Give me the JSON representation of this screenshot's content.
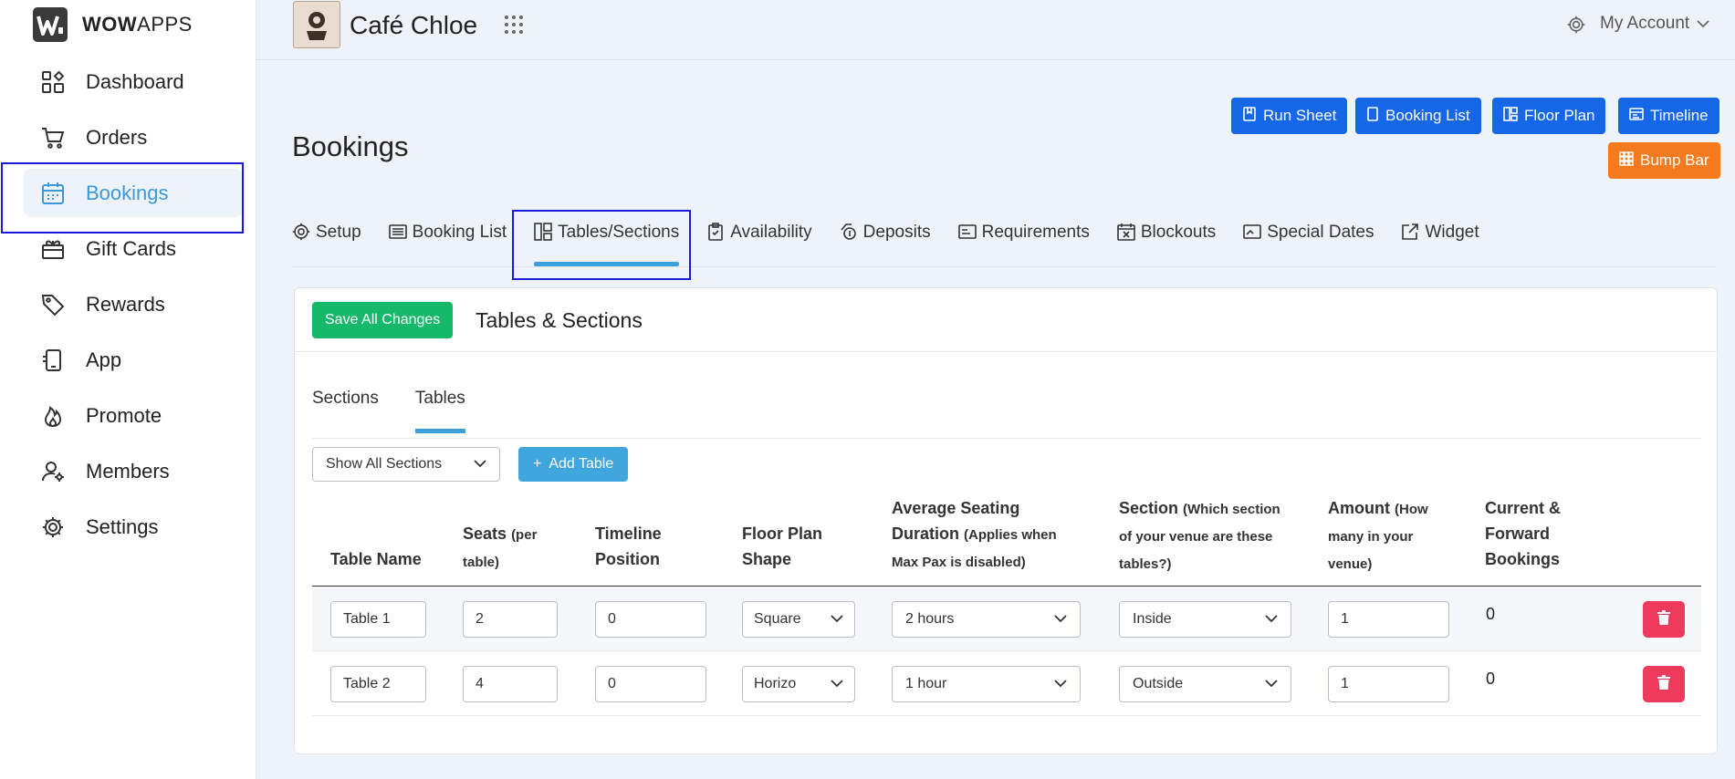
{
  "app": {
    "logo_bold": "WOW",
    "logo_light": "APPS"
  },
  "sidebar": {
    "items": [
      {
        "label": "Dashboard",
        "icon": "dashboard-icon"
      },
      {
        "label": "Orders",
        "icon": "cart-icon"
      },
      {
        "label": "Bookings",
        "icon": "calendar-icon",
        "active": true
      },
      {
        "label": "Gift Cards",
        "icon": "gift-card-icon"
      },
      {
        "label": "Rewards",
        "icon": "tag-icon"
      },
      {
        "label": "App",
        "icon": "mobile-icon"
      },
      {
        "label": "Promote",
        "icon": "flame-icon"
      },
      {
        "label": "Members",
        "icon": "members-icon"
      },
      {
        "label": "Settings",
        "icon": "gear-icon"
      }
    ]
  },
  "topbar": {
    "venue_name": "Café Chloe",
    "account_label": "My Account"
  },
  "page": {
    "title": "Bookings",
    "actions": {
      "run_sheet": "Run Sheet",
      "booking_list": "Booking List",
      "floor_plan": "Floor Plan",
      "timeline": "Timeline",
      "bump_bar": "Bump Bar"
    },
    "tabs": [
      {
        "label": "Setup"
      },
      {
        "label": "Booking List"
      },
      {
        "label": "Tables/Sections",
        "active": true
      },
      {
        "label": "Availability"
      },
      {
        "label": "Deposits"
      },
      {
        "label": "Requirements"
      },
      {
        "label": "Blockouts"
      },
      {
        "label": "Special Dates"
      },
      {
        "label": "Widget"
      }
    ]
  },
  "card": {
    "save_label": "Save All Changes",
    "title": "Tables & Sections",
    "subtabs": {
      "sections": "Sections",
      "tables": "Tables"
    },
    "filter_value": "Show All Sections",
    "add_table_label": "Add Table",
    "columns": {
      "name": "Table Name",
      "seats": "Seats",
      "seats_note": "(per",
      "seats_note2": "table)",
      "timeline_1": "Timeline",
      "timeline_2": "Position",
      "shape_1": "Floor Plan",
      "shape_2": "Shape",
      "duration_1": "Average Seating",
      "duration_2": "Duration",
      "duration_note": "(Applies when",
      "duration_note2": "Max Pax is disabled)",
      "section": "Section",
      "section_note": "(Which section",
      "section_note2": "of your venue are these",
      "section_note3": "tables?)",
      "amount": "Amount",
      "amount_note": "(How",
      "amount_note2": "many in your",
      "amount_note3": "venue)",
      "bookings_1": "Current &",
      "bookings_2": "Forward",
      "bookings_3": "Bookings"
    },
    "rows": [
      {
        "name": "Table 1",
        "seats": "2",
        "timeline": "0",
        "shape": "Square",
        "duration": "2 hours",
        "section": "Inside",
        "amount": "1",
        "bookings": "0"
      },
      {
        "name": "Table 2",
        "seats": "4",
        "timeline": "0",
        "shape": "Horizo",
        "duration": "1 hour",
        "section": "Outside",
        "amount": "1",
        "bookings": "0"
      }
    ]
  },
  "colors": {
    "primary": "#1567e8",
    "accent": "#3ba0de",
    "success": "#16b96a",
    "danger": "#ee3a5d",
    "warning": "#f47a1f",
    "highlight_box": "#1a1adb"
  }
}
